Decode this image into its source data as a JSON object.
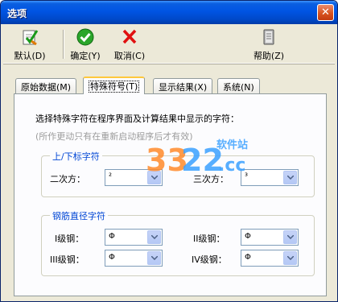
{
  "window": {
    "title": "选项"
  },
  "toolbar": {
    "default_label": "默认(D)",
    "ok_label": "确定(Y)",
    "cancel_label": "取消(C)",
    "help_label": "帮助(Z)"
  },
  "tabs": [
    {
      "label": "原始数据(M)"
    },
    {
      "label": "特殊符号(T)"
    },
    {
      "label": "显示结果(X)"
    },
    {
      "label": "系统(N)"
    }
  ],
  "panel": {
    "description": "选择特殊字符在程序界面及计算结果中显示的字符：",
    "hint": "(所作更动只有在重新启动程序后才有效)",
    "superscript_group": {
      "title": "上/下标字符",
      "square_label": "二次方：",
      "square_value": "²",
      "cube_label": "三次方：",
      "cube_value": "³"
    },
    "rebar_group": {
      "title": "钢筋直径字符",
      "grade1_label": "I级钢：",
      "grade1_value": "Φ",
      "grade2_label": "II级钢：",
      "grade2_value": "Φ",
      "grade3_label": "III级钢：",
      "grade3_value": "Φ",
      "grade4_label": "IV级钢：",
      "grade4_value": "Φ"
    }
  },
  "watermark": {
    "text": "3322.cc",
    "tag": "软件站"
  },
  "colors": {
    "titlebar": "#0054e3",
    "group_title": "#0046d5",
    "panel_bg": "#fcfcfe",
    "window_bg": "#ece9d8"
  }
}
